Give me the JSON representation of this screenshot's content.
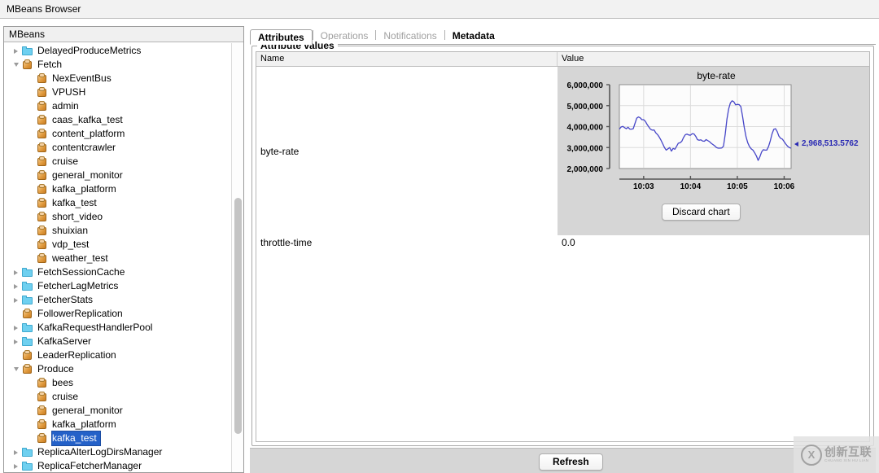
{
  "window": {
    "title": "MBeans Browser"
  },
  "sidebar": {
    "header": "MBeans",
    "items": [
      {
        "label": "DelayedProduceMetrics",
        "icon": "folder-icon",
        "indent": 1,
        "twist": "closed"
      },
      {
        "label": "Fetch",
        "icon": "mbean-icon",
        "indent": 1,
        "twist": "open"
      },
      {
        "label": "NexEventBus",
        "icon": "mbean-icon",
        "indent": 2,
        "twist": "none"
      },
      {
        "label": "VPUSH",
        "icon": "mbean-icon",
        "indent": 2,
        "twist": "none"
      },
      {
        "label": "admin",
        "icon": "mbean-icon",
        "indent": 2,
        "twist": "none"
      },
      {
        "label": "caas_kafka_test",
        "icon": "mbean-icon",
        "indent": 2,
        "twist": "none"
      },
      {
        "label": "content_platform",
        "icon": "mbean-icon",
        "indent": 2,
        "twist": "none"
      },
      {
        "label": "contentcrawler",
        "icon": "mbean-icon",
        "indent": 2,
        "twist": "none"
      },
      {
        "label": "cruise",
        "icon": "mbean-icon",
        "indent": 2,
        "twist": "none"
      },
      {
        "label": "general_monitor",
        "icon": "mbean-icon",
        "indent": 2,
        "twist": "none"
      },
      {
        "label": "kafka_platform",
        "icon": "mbean-icon",
        "indent": 2,
        "twist": "none"
      },
      {
        "label": "kafka_test",
        "icon": "mbean-icon",
        "indent": 2,
        "twist": "none"
      },
      {
        "label": "short_video",
        "icon": "mbean-icon",
        "indent": 2,
        "twist": "none"
      },
      {
        "label": "shuixian",
        "icon": "mbean-icon",
        "indent": 2,
        "twist": "none"
      },
      {
        "label": "vdp_test",
        "icon": "mbean-icon",
        "indent": 2,
        "twist": "none"
      },
      {
        "label": "weather_test",
        "icon": "mbean-icon",
        "indent": 2,
        "twist": "none"
      },
      {
        "label": "FetchSessionCache",
        "icon": "folder-icon",
        "indent": 1,
        "twist": "closed"
      },
      {
        "label": "FetcherLagMetrics",
        "icon": "folder-icon",
        "indent": 1,
        "twist": "closed"
      },
      {
        "label": "FetcherStats",
        "icon": "folder-icon",
        "indent": 1,
        "twist": "closed"
      },
      {
        "label": "FollowerReplication",
        "icon": "mbean-icon",
        "indent": 1,
        "twist": "none"
      },
      {
        "label": "KafkaRequestHandlerPool",
        "icon": "folder-icon",
        "indent": 1,
        "twist": "closed"
      },
      {
        "label": "KafkaServer",
        "icon": "folder-icon",
        "indent": 1,
        "twist": "closed"
      },
      {
        "label": "LeaderReplication",
        "icon": "mbean-icon",
        "indent": 1,
        "twist": "none"
      },
      {
        "label": "Produce",
        "icon": "mbean-icon",
        "indent": 1,
        "twist": "open"
      },
      {
        "label": "bees",
        "icon": "mbean-icon",
        "indent": 2,
        "twist": "none"
      },
      {
        "label": "cruise",
        "icon": "mbean-icon",
        "indent": 2,
        "twist": "none"
      },
      {
        "label": "general_monitor",
        "icon": "mbean-icon",
        "indent": 2,
        "twist": "none"
      },
      {
        "label": "kafka_platform",
        "icon": "mbean-icon",
        "indent": 2,
        "twist": "none"
      },
      {
        "label": "kafka_test",
        "icon": "mbean-icon",
        "indent": 2,
        "twist": "none",
        "selected": true
      },
      {
        "label": "ReplicaAlterLogDirsManager",
        "icon": "folder-icon",
        "indent": 1,
        "twist": "closed"
      },
      {
        "label": "ReplicaFetcherManager",
        "icon": "folder-icon",
        "indent": 1,
        "twist": "closed"
      }
    ]
  },
  "tabs": [
    {
      "label": "Attributes",
      "state": "active"
    },
    {
      "label": "Operations",
      "state": "disabled"
    },
    {
      "label": "Notifications",
      "state": "disabled"
    },
    {
      "label": "Metadata",
      "state": "enabled"
    }
  ],
  "attribute_panel": {
    "group_title": "Attribute values",
    "columns": [
      "Name",
      "Value"
    ],
    "rows": [
      {
        "name": "byte-rate",
        "kind": "chart",
        "value": ""
      },
      {
        "name": "throttle-time",
        "kind": "text",
        "value": "0.0"
      }
    ],
    "discard_button": "Discard chart"
  },
  "footer": {
    "refresh_button": "Refresh"
  },
  "watermark": {
    "mark": "X",
    "cn": "创新互联",
    "pinyin": "CHUANG XIN HU LIAN"
  },
  "chart_data": {
    "type": "line",
    "title": "byte-rate",
    "xlabel": "",
    "ylabel": "",
    "ylim": [
      2000000,
      6000000
    ],
    "ytick_labels": [
      "6,000,000",
      "5,000,000",
      "4,000,000",
      "3,000,000",
      "2,000,000"
    ],
    "yticks": [
      6000000,
      5000000,
      4000000,
      3000000,
      2000000
    ],
    "xtick_labels": [
      "10:03",
      "10:04",
      "10:05",
      "10:06"
    ],
    "grid": true,
    "legend": "none",
    "line_color": "#4646c8",
    "current_value_label": "2,968,513.5762",
    "current_value": 2968513.5762,
    "series": [
      {
        "name": "byte-rate",
        "values": [
          3880000,
          3980000,
          4010000,
          3950000,
          3900000,
          3970000,
          3880000,
          3880000,
          3900000,
          4150000,
          4400000,
          4460000,
          4420000,
          4330000,
          4330000,
          4250000,
          4100000,
          3980000,
          3870000,
          3830000,
          3840000,
          3700000,
          3620000,
          3500000,
          3350000,
          3180000,
          3000000,
          2880000,
          2940000,
          3000000,
          2830000,
          2960000,
          2920000,
          3060000,
          3210000,
          3230000,
          3300000,
          3480000,
          3610000,
          3640000,
          3600000,
          3590000,
          3660000,
          3650000,
          3540000,
          3380000,
          3350000,
          3370000,
          3310000,
          3300000,
          3380000,
          3330000,
          3280000,
          3200000,
          3140000,
          3080000,
          3000000,
          2970000,
          2970000,
          2980000,
          3060000,
          3620000,
          4350000,
          4840000,
          5130000,
          5230000,
          5180000,
          5040000,
          5060000,
          5050000,
          4960000,
          4500000,
          3960000,
          3520000,
          3230000,
          3050000,
          2940000,
          2880000,
          2750000,
          2600000,
          2390000,
          2560000,
          2790000,
          2900000,
          2880000,
          2880000,
          3050000,
          3320000,
          3650000,
          3870000,
          3900000,
          3760000,
          3540000,
          3440000,
          3400000,
          3280000,
          3160000,
          3060000,
          3000000,
          2968513
        ]
      }
    ]
  }
}
